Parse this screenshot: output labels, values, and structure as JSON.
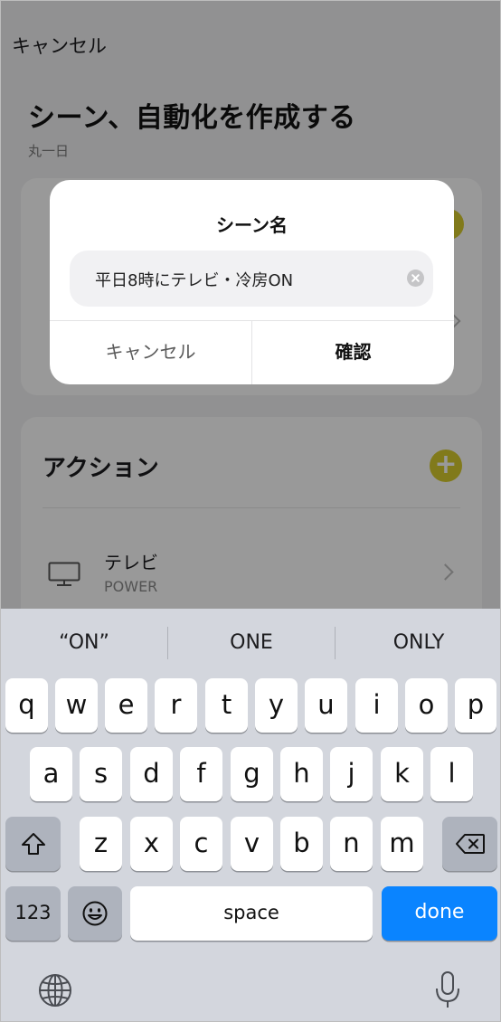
{
  "header": {
    "cancel_label": "キャンセル"
  },
  "page": {
    "title": "シーン、自動化を作成する",
    "subtitle": "丸一日"
  },
  "actions": {
    "title": "アクション",
    "items": [
      {
        "name": "テレビ",
        "sub": "POWER",
        "icon": "tv-icon"
      }
    ]
  },
  "dialog": {
    "title": "シーン名",
    "field_value": "平日8時にテレビ・冷房ON",
    "cancel_label": "キャンセル",
    "confirm_label": "確認"
  },
  "keyboard": {
    "suggestions": [
      "“ON”",
      "ONE",
      "ONLY"
    ],
    "row1": [
      "q",
      "w",
      "e",
      "r",
      "t",
      "y",
      "u",
      "i",
      "o",
      "p"
    ],
    "row2": [
      "a",
      "s",
      "d",
      "f",
      "g",
      "h",
      "j",
      "k",
      "l"
    ],
    "row3": [
      "z",
      "x",
      "c",
      "v",
      "b",
      "n",
      "m"
    ],
    "numbers_label": "123",
    "space_label": "space",
    "done_label": "done",
    "icons": [
      "shift-icon",
      "backspace-icon",
      "emoji-icon",
      "globe-icon",
      "microphone-icon"
    ]
  },
  "colors": {
    "accent_yellow": "#d8cb2e",
    "done_blue": "#0a84ff"
  }
}
